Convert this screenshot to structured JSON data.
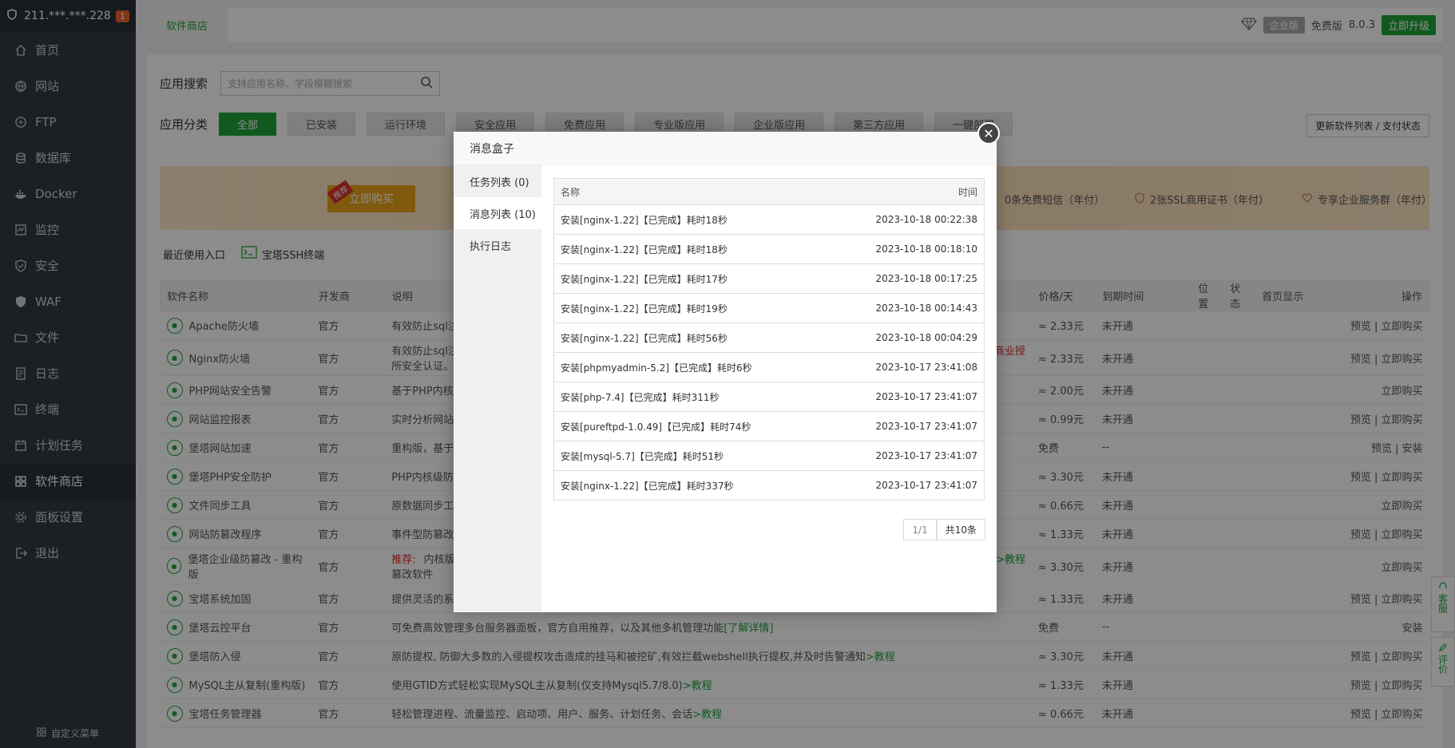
{
  "sidebar": {
    "ip": "211.***.***.228",
    "badge": "1",
    "items": [
      {
        "label": "首页",
        "icon": "home-icon"
      },
      {
        "label": "网站",
        "icon": "globe-icon"
      },
      {
        "label": "FTP",
        "icon": "ftp-icon"
      },
      {
        "label": "数据库",
        "icon": "database-icon"
      },
      {
        "label": "Docker",
        "icon": "docker-icon"
      },
      {
        "label": "监控",
        "icon": "monitor-icon"
      },
      {
        "label": "安全",
        "icon": "shield-icon"
      },
      {
        "label": "WAF",
        "icon": "waf-icon"
      },
      {
        "label": "文件",
        "icon": "folder-icon"
      },
      {
        "label": "日志",
        "icon": "log-icon"
      },
      {
        "label": "终端",
        "icon": "terminal-icon"
      },
      {
        "label": "计划任务",
        "icon": "calendar-icon"
      },
      {
        "label": "软件商店",
        "icon": "grid-icon"
      },
      {
        "label": "面板设置",
        "icon": "gear-icon"
      },
      {
        "label": "退出",
        "icon": "logout-icon"
      }
    ],
    "active_index": 12,
    "footer": "自定义菜单"
  },
  "topbar": {
    "tab": "软件商店",
    "edition": "企业版",
    "free": "免费版",
    "version": "8.0.3",
    "upgrade": "立即升级"
  },
  "store": {
    "search_label": "应用搜索",
    "search_placeholder": "支持应用名称、字段模糊搜索",
    "category_label": "应用分类",
    "categories": [
      "全部",
      "已安装",
      "运行环境",
      "安全应用",
      "免费应用",
      "专业版应用",
      "企业版应用",
      "第三方应用",
      "一键部署"
    ],
    "refresh": "更新软件列表 / 支付状态",
    "banner_buy": "立即购买",
    "banner_tag": "推荐",
    "banner_perks": [
      "0条免费短信（年付）",
      "2张SSL商用证书（年付）",
      "专享企业服务群（年付）"
    ],
    "recent_label": "最近使用入口",
    "recent_ssh": "宝塔SSH终端",
    "columns": [
      "软件名称",
      "开发商",
      "说明",
      "价格/天",
      "到期时间",
      "位置",
      "状态",
      "首页显示",
      "操作"
    ],
    "rows": [
      {
        "name": "Apache防火墙",
        "dev": "官方",
        "desc": "有效防止sql注入",
        "price": "≈ 2.33元",
        "expire": "未开通",
        "ops": "预览 | 立即购买"
      },
      {
        "name": "Nginx防火墙",
        "dev": "官方",
        "desc": "有效防止sql注入",
        "desc2": "所安全认证。",
        "extra": "商业授",
        "price": "≈ 2.33元",
        "expire": "未开通",
        "ops": "预览 | 立即购买"
      },
      {
        "name": "PHP网站安全告警",
        "dev": "官方",
        "desc": "基于PHP内核的",
        "price": "≈ 2.00元",
        "expire": "未开通",
        "ops": "立即购买"
      },
      {
        "name": "网站监控报表",
        "dev": "官方",
        "desc": "实时分析网站",
        "price": "≈ 0.99元",
        "expire": "未开通",
        "ops": "预览 | 立即购买"
      },
      {
        "name": "堡塔网站加速",
        "dev": "官方",
        "desc": "重构版，基于",
        "price": "免费",
        "expire": "--",
        "ops": "预览 | 安装"
      },
      {
        "name": "堡塔PHP安全防护",
        "dev": "官方",
        "desc": "PHP内核级防",
        "price": "≈ 3.30元",
        "expire": "未开通",
        "ops": "预览 | 立即购买"
      },
      {
        "name": "文件同步工具",
        "dev": "官方",
        "desc": "原数据同步工具",
        "price": "≈ 0.66元",
        "expire": "未开通",
        "ops": "立即购买"
      },
      {
        "name": "网站防篡改程序",
        "dev": "官方",
        "desc": "事件型防篡改",
        "price": "≈ 1.33元",
        "expire": "未开通",
        "ops": "预览 | 立即购买"
      },
      {
        "name": "堡塔企业级防篡改 - 重构版",
        "dev": "官方",
        "desc": "内核版防",
        "desc2": "篡改软件",
        "tag": "推荐:",
        "extra": ">>教程",
        "price": "≈ 3.30元",
        "expire": "未开通",
        "ops": "立即购买"
      },
      {
        "name": "宝塔系统加固",
        "dev": "官方",
        "desc": "提供灵活的系统加固功能，防止系统被植入木马，支持服务器日志审计，等保加固功能",
        "price": "≈ 1.33元",
        "expire": "未开通",
        "ops": "预览 | 立即购买"
      },
      {
        "name": "堡塔云控平台",
        "dev": "官方",
        "desc": "可免费高效管理多台服务器面板，官方自用推荐，以及其他多机管理功能",
        "link": "[了解详情]",
        "price": "免费",
        "expire": "--",
        "ops": "安装"
      },
      {
        "name": "堡塔防入侵",
        "dev": "官方",
        "desc": "原防提权, 防御大多数的入侵提权攻击造成的挂马和被挖矿,有效拦截webshell执行提权,并及时告警通知",
        "link": ">教程",
        "price": "≈ 3.30元",
        "expire": "未开通",
        "ops": "预览 | 立即购买"
      },
      {
        "name": "MySQL主从复制(重构版)",
        "dev": "官方",
        "desc": "使用GTID方式轻松实现MySQL主从复制(仅支持Mysql5.7/8.0)",
        "link": ">教程",
        "price": "≈ 1.33元",
        "expire": "未开通",
        "ops": "预览 | 立即购买"
      },
      {
        "name": "宝塔任务管理器",
        "dev": "官方",
        "desc": "轻松管理进程、流量监控、启动项、用户、服务、计划任务、会话",
        "link": ">教程",
        "price": "≈ 0.66元",
        "expire": "未开通",
        "ops": "预览 | 立即购买"
      }
    ]
  },
  "modal": {
    "title": "消息盒子",
    "nav": [
      "任务列表 (0)",
      "消息列表 (10)",
      "执行日志"
    ],
    "active_nav": 1,
    "col_name": "名称",
    "col_time": "时间",
    "messages": [
      {
        "name": "安装[nginx-1.22]【已完成】耗时18秒",
        "time": "2023-10-18 00:22:38"
      },
      {
        "name": "安装[nginx-1.22]【已完成】耗时18秒",
        "time": "2023-10-18 00:18:10"
      },
      {
        "name": "安装[nginx-1.22]【已完成】耗时17秒",
        "time": "2023-10-18 00:17:25"
      },
      {
        "name": "安装[nginx-1.22]【已完成】耗时19秒",
        "time": "2023-10-18 00:14:43"
      },
      {
        "name": "安装[nginx-1.22]【已完成】耗时56秒",
        "time": "2023-10-18 00:04:29"
      },
      {
        "name": "安装[phpmyadmin-5.2]【已完成】耗时6秒",
        "time": "2023-10-17 23:41:08"
      },
      {
        "name": "安装[php-7.4]【已完成】耗时311秒",
        "time": "2023-10-17 23:41:07"
      },
      {
        "name": "安装[pureftpd-1.0.49]【已完成】耗时74秒",
        "time": "2023-10-17 23:41:07"
      },
      {
        "name": "安装[mysql-5.7]【已完成】耗时51秒",
        "time": "2023-10-17 23:41:07"
      },
      {
        "name": "安装[nginx-1.22]【已完成】耗时337秒",
        "time": "2023-10-17 23:41:07"
      }
    ],
    "page": "1/1",
    "total": "共10条"
  },
  "float": {
    "service": "客服",
    "review": "评价"
  }
}
